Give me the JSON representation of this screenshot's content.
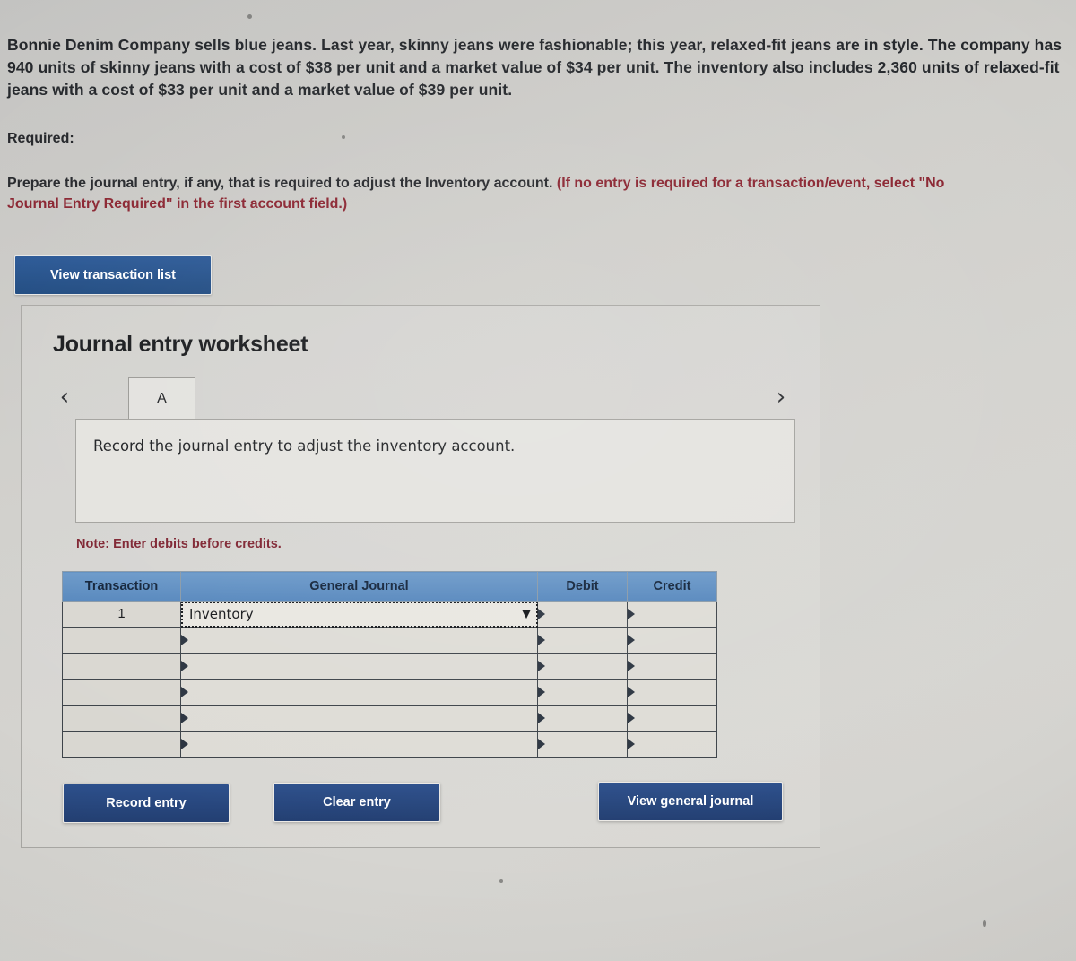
{
  "problem": {
    "text": "Bonnie Denim Company sells blue jeans. Last year, skinny jeans were fashionable; this year, relaxed-fit jeans are in style. The company has 940 units of skinny jeans with a cost of $38 per unit and a market value of $34 per unit. The inventory also includes 2,360 units of relaxed-fit jeans with a cost of $33 per unit and a market value of $39 per unit."
  },
  "required": {
    "label": "Required:",
    "body": "Prepare the journal entry, if any, that is required to adjust the Inventory account. ",
    "hint": "(If no entry is required for a transaction/event, select \"No Journal Entry Required\" in the first account field.)"
  },
  "toolbar": {
    "view_transaction_list": "View transaction list"
  },
  "worksheet": {
    "title": "Journal entry worksheet",
    "nav": {
      "prev_icon": "‹",
      "next_icon": "›"
    },
    "tabs": [
      {
        "label": "A",
        "active": true
      }
    ],
    "instruction": "Record the journal entry to adjust the inventory account.",
    "note": "Note: Enter debits before credits.",
    "table": {
      "headers": [
        "Transaction",
        "General Journal",
        "Debit",
        "Credit"
      ],
      "rows": [
        {
          "transaction": "1",
          "general_journal": "Inventory",
          "debit": "",
          "credit": "",
          "has_select": true
        },
        {
          "transaction": "",
          "general_journal": "",
          "debit": "",
          "credit": "",
          "has_select": false
        },
        {
          "transaction": "",
          "general_journal": "",
          "debit": "",
          "credit": "",
          "has_select": false
        },
        {
          "transaction": "",
          "general_journal": "",
          "debit": "",
          "credit": "",
          "has_select": false
        },
        {
          "transaction": "",
          "general_journal": "",
          "debit": "",
          "credit": "",
          "has_select": false
        },
        {
          "transaction": "",
          "general_journal": "",
          "debit": "",
          "credit": "",
          "has_select": false
        }
      ],
      "select_caret_icon": "▼"
    },
    "buttons": {
      "record_entry": "Record entry",
      "clear_entry": "Clear entry",
      "view_general_journal": "View general journal"
    }
  },
  "colors": {
    "primary_button": "#23518b",
    "table_header": "#5e8fc2",
    "hint_text": "#8a2430",
    "note_text": "#7e2330",
    "page_background": "#d2d1cd"
  }
}
